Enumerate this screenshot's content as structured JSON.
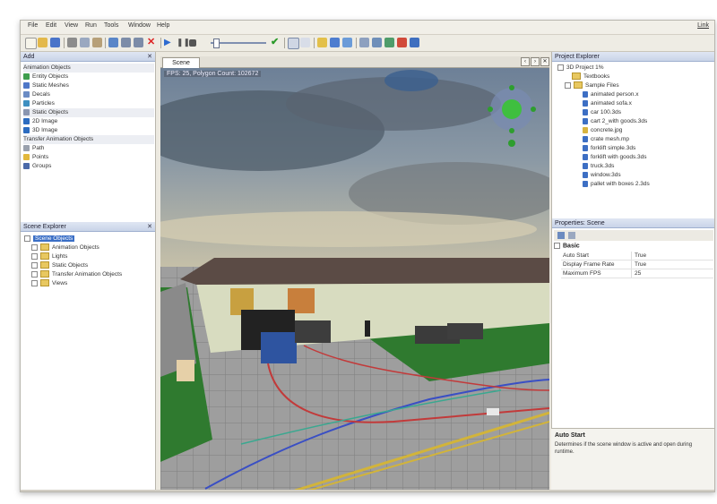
{
  "menu": [
    "File",
    "Edit",
    "View",
    "Run",
    "Tools",
    "Window",
    "Help"
  ],
  "top_right_link": "Link",
  "left_panel": {
    "title": "Add",
    "items": [
      "Animation Objects",
      "Entity Objects",
      "Static Meshes",
      "Decals",
      "Particles",
      "Static Objects",
      "2D Image",
      "3D Image",
      "Transfer Animation Objects",
      "Path",
      "Points",
      "Groups"
    ]
  },
  "scene_explorer": {
    "title": "Scene Explorer",
    "root": "Scene Objects",
    "children": [
      "Animation Objects",
      "Lights",
      "Static Objects",
      "Transfer Animation Objects",
      "Views"
    ]
  },
  "viewport": {
    "tab_label": "Scene",
    "overlay": "FPS: 25, Polygon Count: 102672"
  },
  "project_explorer": {
    "title": "Project Explorer",
    "root": "3D Project 1%",
    "folders": [
      "Textbooks",
      "Sample Files"
    ],
    "files": [
      "animated person.x",
      "animated sofa.x",
      "car 100.3ds",
      "cart 2_with goods.3ds",
      "concrete.jpg",
      "crate mesh.mp",
      "forklift simple.3ds",
      "forklift with goods.3ds",
      "truck.3ds",
      "window.3ds",
      "pallet with boxes 2.3ds"
    ]
  },
  "properties": {
    "title": "Properties: Scene",
    "section": "Basic",
    "rows": [
      {
        "key": "Auto Start",
        "value": "True"
      },
      {
        "key": "Display Frame Rate",
        "value": "True"
      },
      {
        "key": "Maximum FPS",
        "value": "25"
      }
    ]
  },
  "description": {
    "title": "Auto Start",
    "text": "Determines if the scene window is active and open during runtime."
  }
}
